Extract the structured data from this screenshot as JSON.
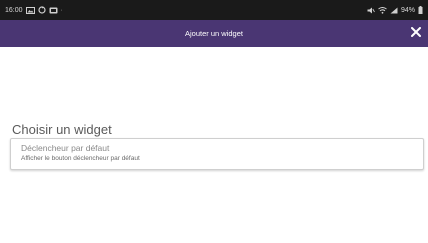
{
  "status_bar": {
    "time": "16:00",
    "battery": "94%",
    "left_icons": [
      "gallery-icon",
      "recycle-icon",
      "notification-icon"
    ],
    "right_icons": [
      "mute-icon",
      "wifi-icon",
      "signal-icon",
      "battery-icon"
    ]
  },
  "header": {
    "title": "Ajouter un widget",
    "close_icon": "close-icon",
    "background": "#4a3673"
  },
  "main": {
    "section_title": "Choisir un widget",
    "widgets": [
      {
        "title": "Déclencheur par défaut",
        "description": "Afficher le bouton déclencheur par défaut"
      }
    ]
  }
}
